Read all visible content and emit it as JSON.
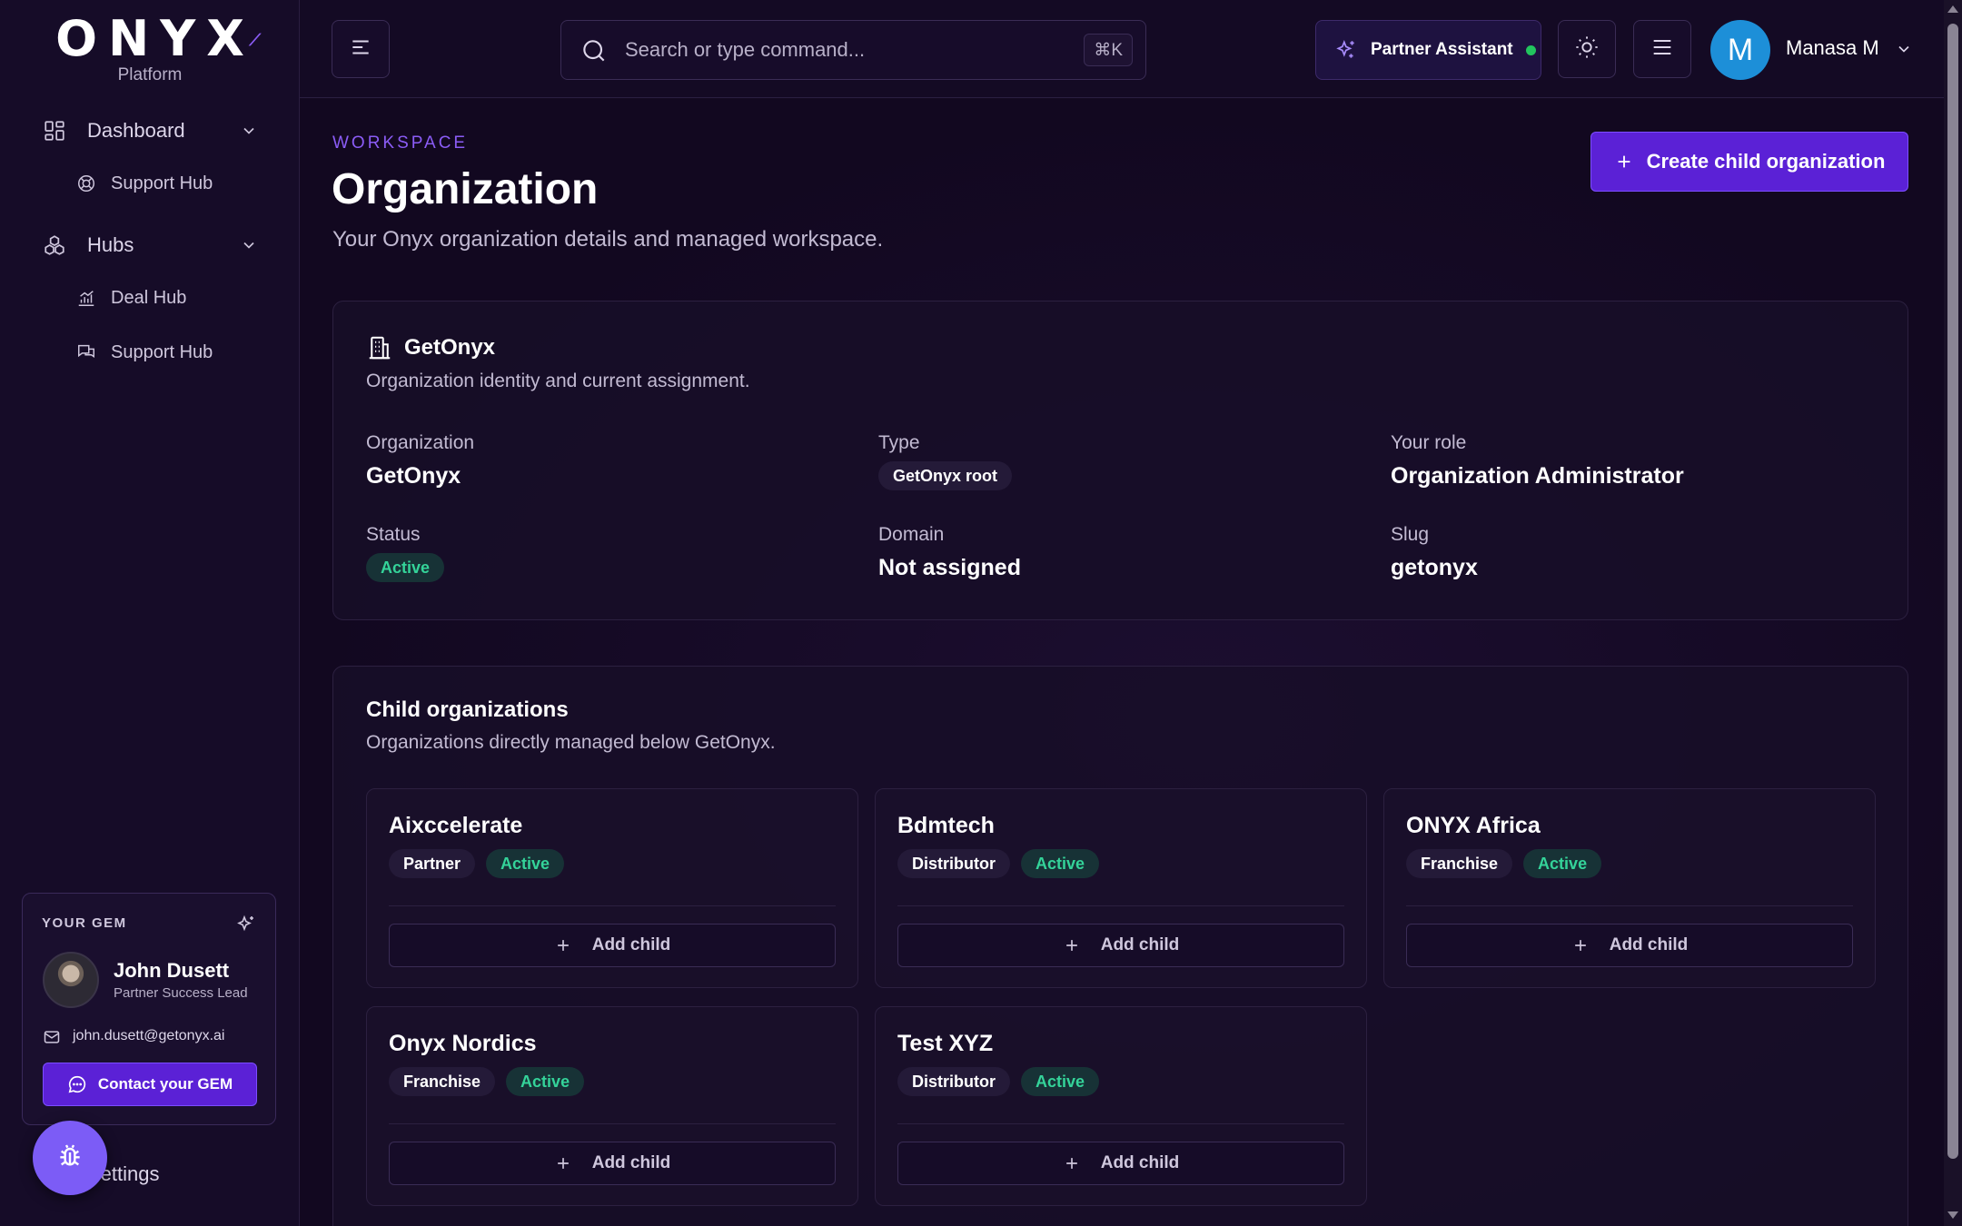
{
  "sidebar": {
    "logo": "ONYX",
    "logo_sub": "Platform",
    "dashboard_label": "Dashboard",
    "dashboard_support_hub": "Support Hub",
    "hubs_label": "Hubs",
    "deal_hub": "Deal Hub",
    "hubs_support_hub": "Support Hub",
    "settings": "Settings"
  },
  "gem": {
    "title": "YOUR GEM",
    "name": "John Dusett",
    "role": "Partner Success Lead",
    "email": "john.dusett@getonyx.ai",
    "contact_label": "Contact your GEM"
  },
  "topbar": {
    "search_placeholder": "Search or type command...",
    "search_shortcut": "⌘K",
    "assistant_label": "Partner Assistant",
    "user_initial": "M",
    "user_name": "Manasa M"
  },
  "page": {
    "eyebrow": "WORKSPACE",
    "title": "Organization",
    "subtitle": "Your Onyx organization details and managed workspace.",
    "create_label": "Create child organization"
  },
  "org": {
    "name": "GetOnyx",
    "description": "Organization identity and current assignment.",
    "fields": {
      "organization_label": "Organization",
      "organization_value": "GetOnyx",
      "type_label": "Type",
      "type_value": "GetOnyx root",
      "role_label": "Your role",
      "role_value": "Organization Administrator",
      "status_label": "Status",
      "status_value": "Active",
      "domain_label": "Domain",
      "domain_value": "Not assigned",
      "slug_label": "Slug",
      "slug_value": "getonyx"
    }
  },
  "children": {
    "title": "Child organizations",
    "description": "Organizations directly managed below GetOnyx.",
    "add_label": "Add child",
    "items": [
      {
        "name": "Aixccelerate",
        "type": "Partner",
        "status": "Active"
      },
      {
        "name": "Bdmtech",
        "type": "Distributor",
        "status": "Active"
      },
      {
        "name": "ONYX Africa",
        "type": "Franchise",
        "status": "Active"
      },
      {
        "name": "Onyx Nordics",
        "type": "Franchise",
        "status": "Active"
      },
      {
        "name": "Test XYZ",
        "type": "Distributor",
        "status": "Active"
      }
    ]
  },
  "colors": {
    "accent": "#5b21d6",
    "active_text": "#34d399",
    "avatar": "#1d8fd8"
  }
}
